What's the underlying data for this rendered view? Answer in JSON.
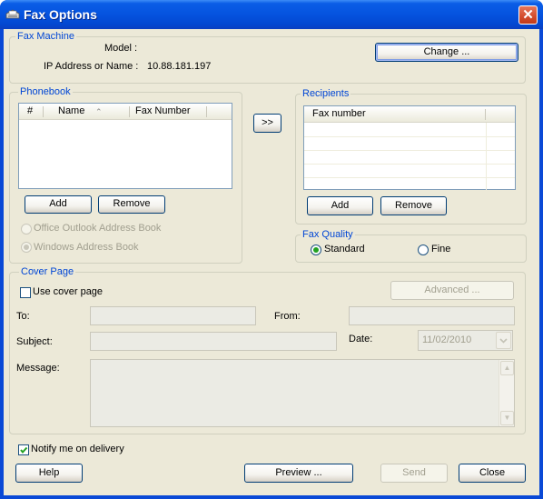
{
  "window": {
    "title": "Fax Options",
    "close": "✕"
  },
  "fax_machine": {
    "legend": "Fax Machine",
    "model_label": "Model :",
    "model_value": "",
    "ip_label": "IP Address or Name :",
    "ip_value": "10.88.181.197",
    "change_button": "Change ..."
  },
  "phonebook": {
    "legend": "Phonebook",
    "columns": [
      "#",
      "Name",
      "Fax Number"
    ],
    "sort_glyph": "⌃",
    "add_button": "Add",
    "remove_button": "Remove",
    "outlook_option": "Office Outlook Address Book",
    "windows_option": "Windows Address Book"
  },
  "transfer_button": ">>",
  "recipients": {
    "legend": "Recipients",
    "column": "Fax number",
    "add_button": "Add",
    "remove_button": "Remove"
  },
  "fax_quality": {
    "legend": "Fax Quality",
    "standard": "Standard",
    "fine": "Fine",
    "selected": "Standard"
  },
  "cover_page": {
    "legend": "Cover Page",
    "use_cover_label": "Use cover page",
    "use_cover_checked": false,
    "advanced_button": "Advanced ...",
    "to_label": "To:",
    "from_label": "From:",
    "subject_label": "Subject:",
    "date_label": "Date:",
    "date_value": "11/02/2010",
    "message_label": "Message:"
  },
  "notify": {
    "label": "Notify me on delivery",
    "checked": true
  },
  "footer": {
    "help": "Help",
    "preview": "Preview ...",
    "send": "Send",
    "close": "Close"
  },
  "colors": {
    "title_bar": "#0553df",
    "dialog_bg": "#ece9d8",
    "group_label": "#0046d5",
    "close_red": "#d34c2c"
  }
}
